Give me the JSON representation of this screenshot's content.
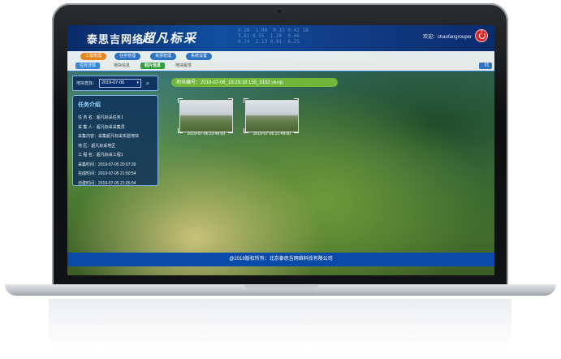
{
  "header": {
    "brand": "泰思吉网络",
    "slogan": "超凡标采",
    "welcome_prefix": "欢迎：",
    "username": "chaofangrouper",
    "numbers_bg": "0.28  1.04  0.13 0.42 18\n3.81 0.55  1.20  0.06\n0.74  2.13 0.91  6.25"
  },
  "menu": {
    "tabs": [
      {
        "label": "工程管理"
      },
      {
        "label": "任务管理"
      },
      {
        "label": "资源管理"
      },
      {
        "label": "系统设置"
      }
    ]
  },
  "subnav": {
    "button": "任务详情",
    "items": [
      {
        "label": "地块信息"
      },
      {
        "label": "照片信息"
      },
      {
        "label": "地块属性"
      }
    ],
    "collapse": "《《"
  },
  "search": {
    "label": "地块查找：",
    "date": "2019-07-06",
    "icon": "search-icon"
  },
  "task_info": {
    "title": "任务介绍",
    "rows": [
      {
        "text": "任 务 名：超凡标采任务1"
      },
      {
        "text": "采 集 人：超凡标采采集员"
      },
      {
        "text": "采集内容：采集超凡标采实验地块"
      },
      {
        "text": "地    区：超凡标采地区"
      },
      {
        "text": "工 程 名：超凡标采工程1"
      },
      {
        "text": "采集时间：2019-07-05 20:07:39"
      },
      {
        "text": "完成时间：2019-07-05 21:50:54"
      },
      {
        "text": "创建时间：2019-07-05 21:05:04"
      }
    ]
  },
  "plot": {
    "label": "地块编号：2019-07-06_18:29:18:155_3192",
    "badge": "(共2张)"
  },
  "photos": [
    {
      "time": "2019-07-06 21:49:00"
    },
    {
      "time": "2019-07-06 21:49:00"
    }
  ],
  "footer": {
    "text": "@2019版权所有：北京泰思吉网络科技有限公司"
  },
  "colors": {
    "banner": "#0e4f9e",
    "active_tab": "#e8861e",
    "tab": "#2c73c4",
    "plot_bar": "#6fb63a",
    "footer": "#0a4aa8",
    "power": "#d42a2a"
  }
}
